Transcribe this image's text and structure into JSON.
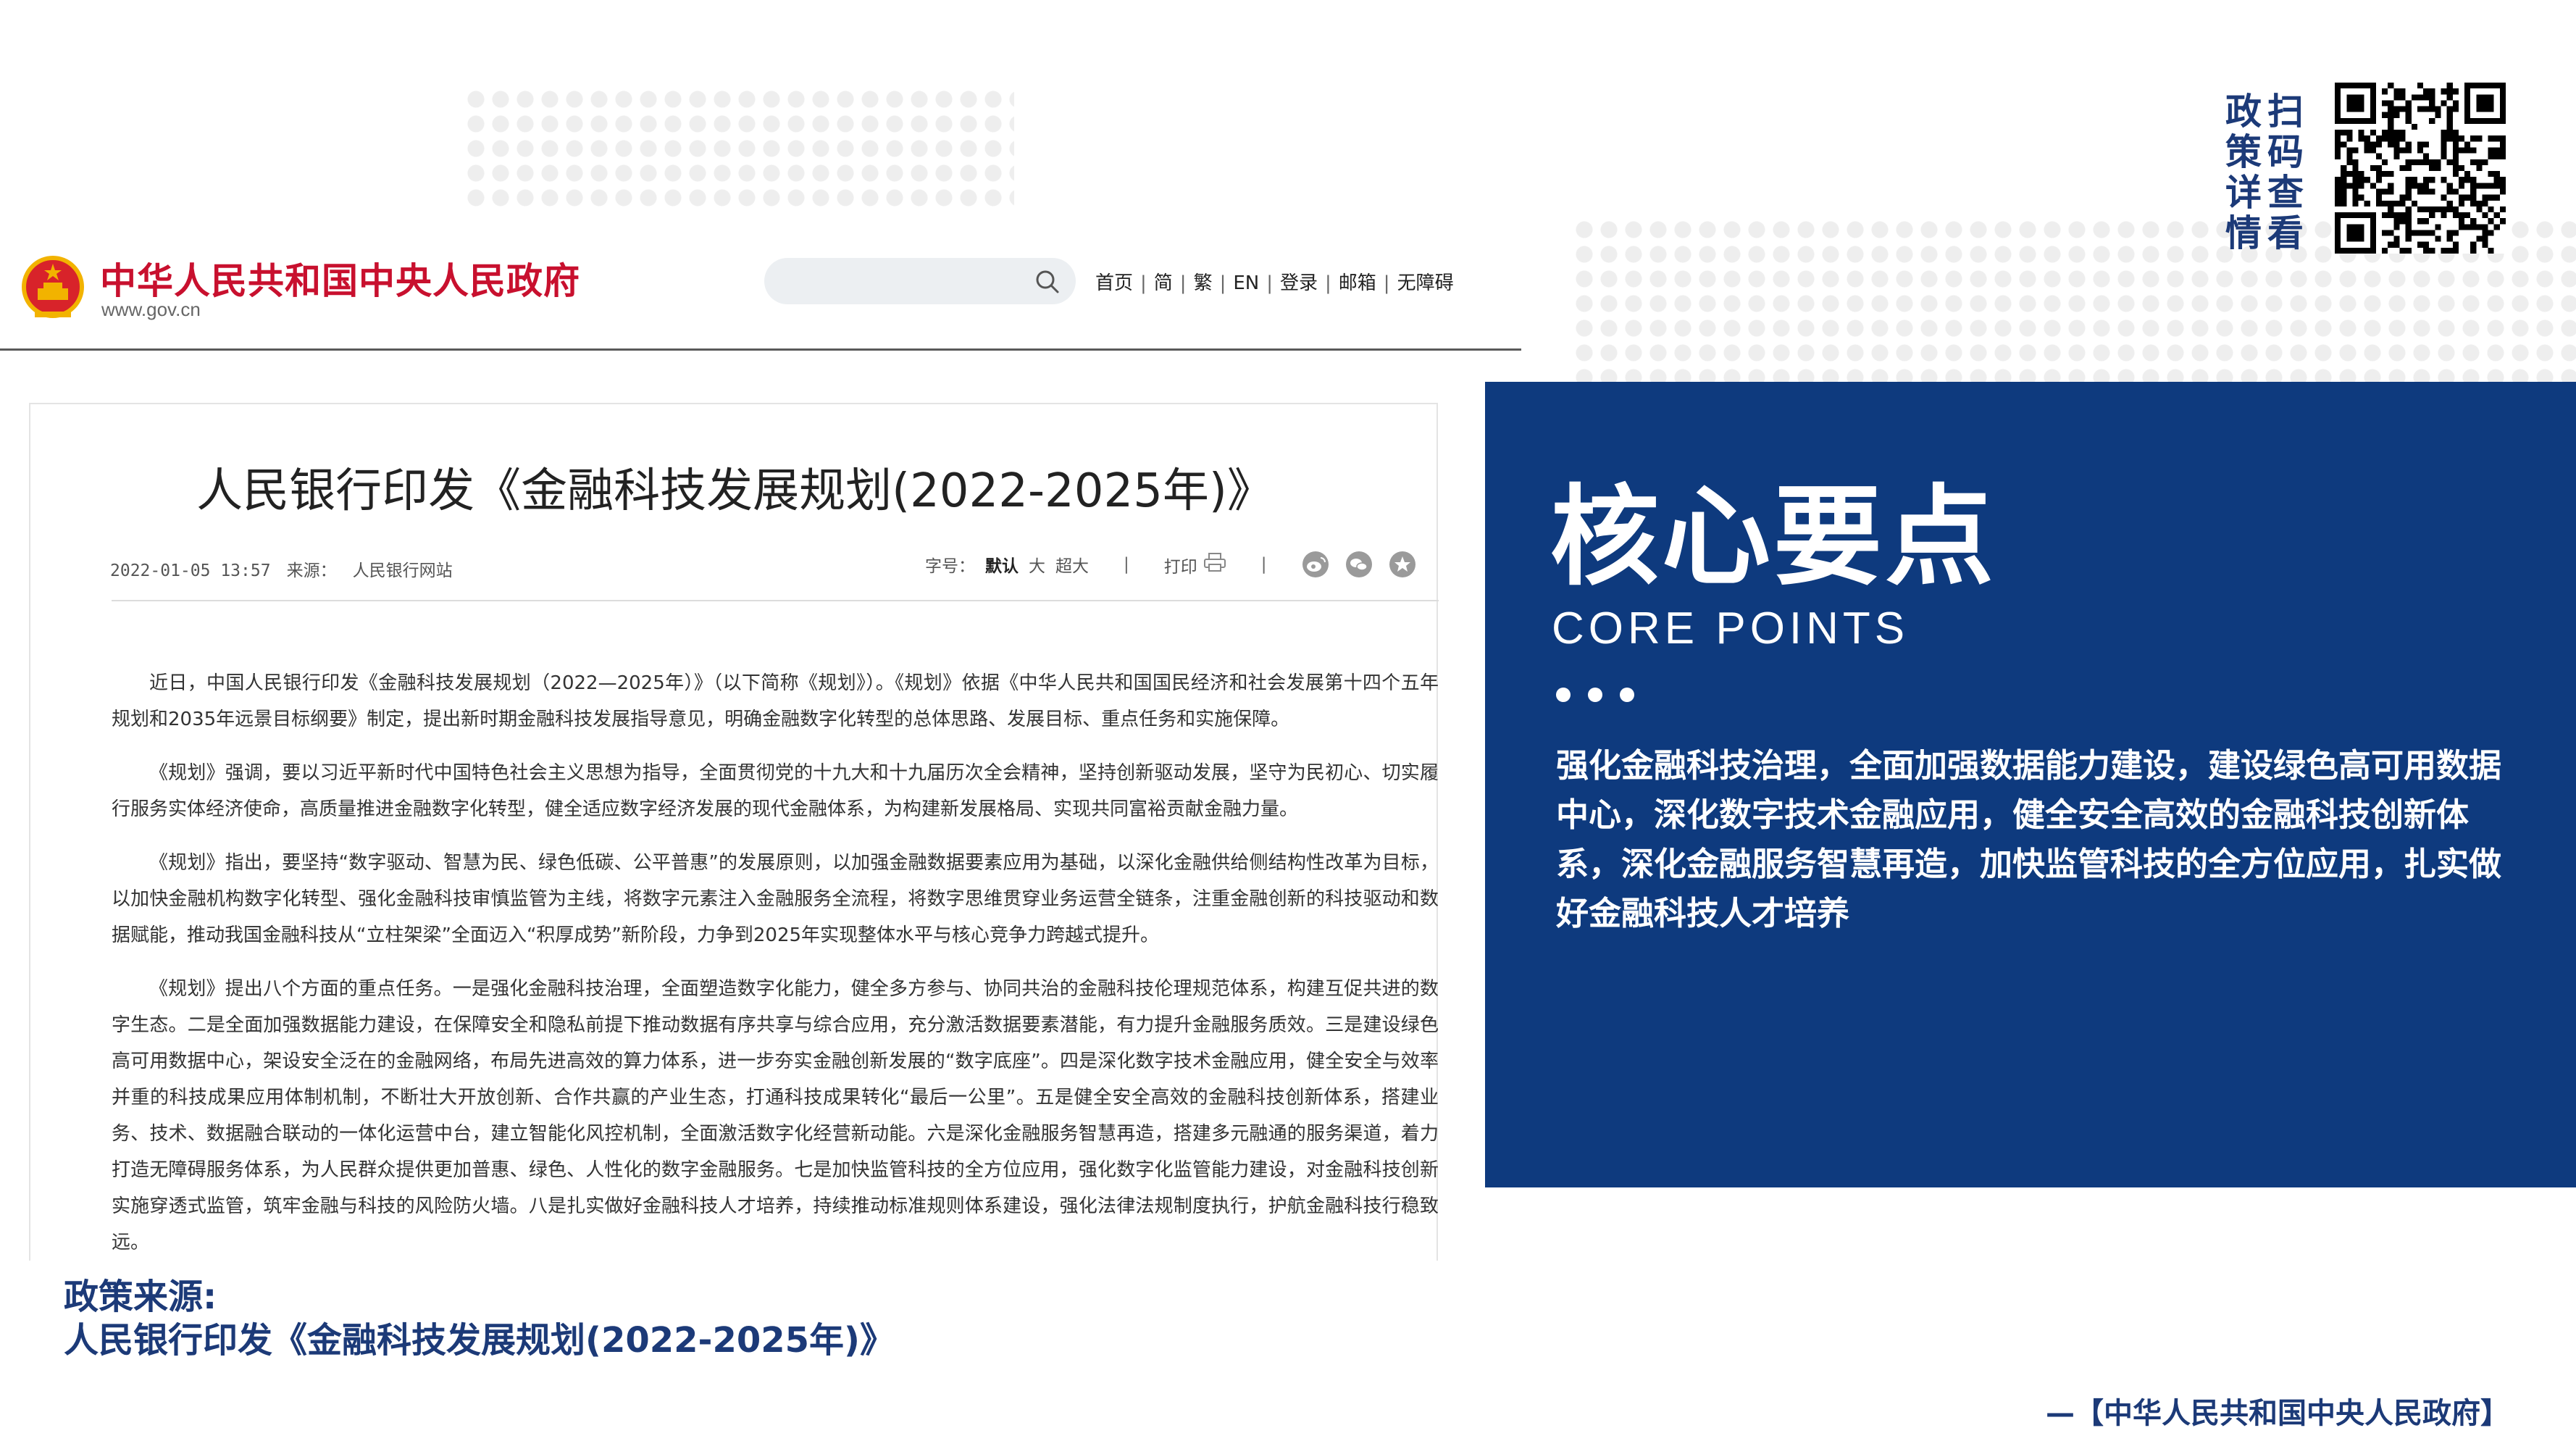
{
  "header": {
    "site_name": "中华人民共和国中央人民政府",
    "site_url": "www.gov.cn",
    "nav": [
      "首页",
      "简",
      "繁",
      "EN",
      "登录",
      "邮箱",
      "无障碍"
    ]
  },
  "article": {
    "title": "人民银行印发《金融科技发展规划(2022-2025年)》",
    "date": "2022-01-05 13:57",
    "source_label": "来源：",
    "source_value": "人民银行网站",
    "font_label": "字号：",
    "font_default": "默认",
    "font_large": "大",
    "font_xlarge": "超大",
    "print_label": "打印",
    "paragraphs": [
      "近日，中国人民银行印发《金融科技发展规划（2022—2025年）》（以下简称《规划》）。《规划》依据《中华人民共和国国民经济和社会发展第十四个五年规划和2035年远景目标纲要》制定，提出新时期金融科技发展指导意见，明确金融数字化转型的总体思路、发展目标、重点任务和实施保障。",
      "《规划》强调，要以习近平新时代中国特色社会主义思想为指导，全面贯彻党的十九大和十九届历次全会精神，坚持创新驱动发展，坚守为民初心、切实履行服务实体经济使命，高质量推进金融数字化转型，健全适应数字经济发展的现代金融体系，为构建新发展格局、实现共同富裕贡献金融力量。",
      "《规划》指出，要坚持“数字驱动、智慧为民、绿色低碳、公平普惠”的发展原则，以加强金融数据要素应用为基础，以深化金融供给侧结构性改革为目标，以加快金融机构数字化转型、强化金融科技审慎监管为主线，将数字元素注入金融服务全流程，将数字思维贯穿业务运营全链条，注重金融创新的科技驱动和数据赋能，推动我国金融科技从“立柱架梁”全面迈入“积厚成势”新阶段，力争到2025年实现整体水平与核心竞争力跨越式提升。",
      "《规划》提出八个方面的重点任务。一是强化金融科技治理，全面塑造数字化能力，健全多方参与、协同共治的金融科技伦理规范体系，构建互促共进的数字生态。二是全面加强数据能力建设，在保障安全和隐私前提下推动数据有序共享与综合应用，充分激活数据要素潜能，有力提升金融服务质效。三是建设绿色高可用数据中心，架设安全泛在的金融网络，布局先进高效的算力体系，进一步夯实金融创新发展的“数字底座”。四是深化数字技术金融应用，健全安全与效率并重的科技成果应用体制机制，不断壮大开放创新、合作共赢的产业生态，打通科技成果转化“最后一公里”。五是健全安全高效的金融科技创新体系，搭建业务、技术、数据融合联动的一体化运营中台，建立智能化风控机制，全面激活数字化经营新动能。六是深化金融服务智慧再造，搭建多元融通的服务渠道，着力打造无障碍服务体系，为人民群众提供更加普惠、绿色、人性化的数字金融服务。七是加快监管科技的全方位应用，强化数字化监管能力建设，对金融科技创新实施穿透式监管，筑牢金融与科技的风险防火墙。八是扎实做好金融科技人才培养，持续推动标准规则体系建设，强化法律法规制度执行，护航金融科技行稳致远。"
    ]
  },
  "qr": {
    "label_col1": [
      "政",
      "策",
      "详",
      "情"
    ],
    "label_col2": [
      "扫",
      "码",
      "查",
      "看"
    ]
  },
  "panel": {
    "title": "核心要点",
    "subtitle": "CORE POINTS",
    "text": "强化金融科技治理，全面加强数据能力建设，建设绿色高可用数据中心，深化数字技术金融应用，健全安全高效的金融科技创新体系，深化金融服务智慧再造，加快监管科技的全方位应用，扎实做好金融科技人才培养"
  },
  "source": {
    "label": "政策来源:",
    "value": "人民银行印发《金融科技发展规划(2022-2025年)》"
  },
  "footer": {
    "attribution": "—【中华人民共和国中央人民政府】"
  },
  "colors": {
    "panel_bg": "#0e3a7e",
    "brand_red": "#c8102e",
    "navy_text": "#1c3a78"
  }
}
